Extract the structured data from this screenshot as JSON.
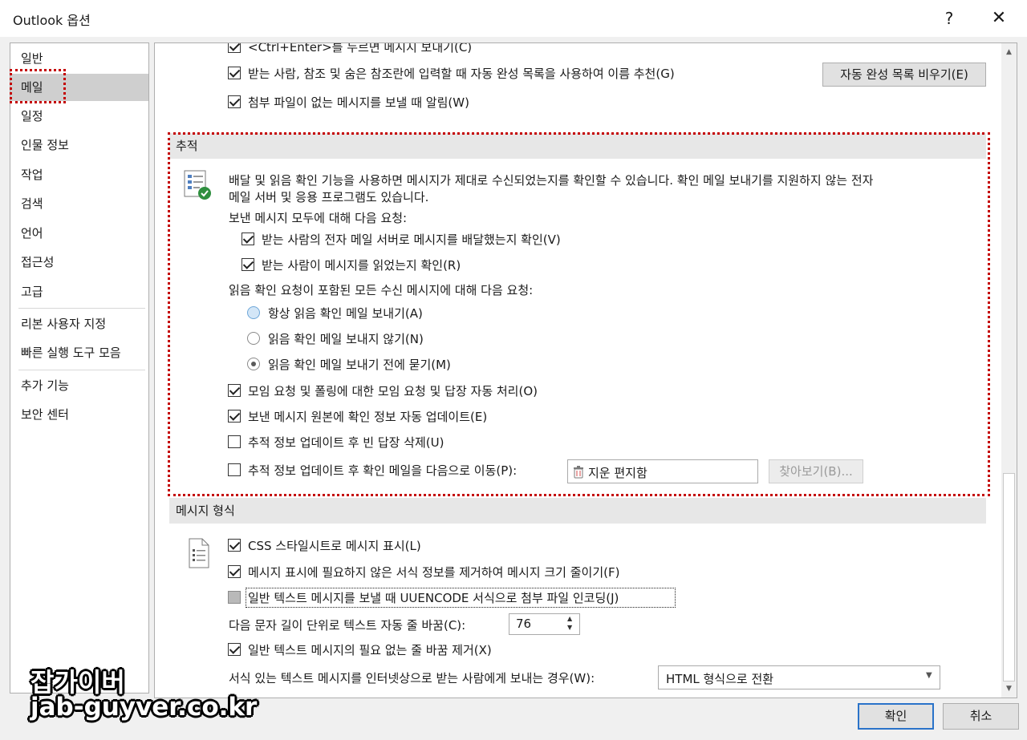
{
  "window": {
    "title": "Outlook 옵션",
    "help": "?",
    "close": "✕"
  },
  "nav": {
    "items": [
      "일반",
      "메일",
      "일정",
      "인물 정보",
      "작업",
      "검색",
      "언어",
      "접근성",
      "고급",
      "리본 사용자 지정",
      "빠른 실행 도구 모음",
      "추가 기능",
      "보안 센터"
    ],
    "active": "메일"
  },
  "compose": {
    "ctrl_enter": "<Ctrl+Enter>를 누르면 메시지 보내기(C)",
    "autocomplete": "받는 사람, 참조 및 숨은 참조란에 입력할 때 자동 완성 목록을 사용하여 이름 추천(G)",
    "attach_warn": "첨부 파일이 없는 메시지를 보낼 때 알림(W)",
    "clear_autocomplete_btn": "자동 완성 목록 비우기(E)"
  },
  "tracking": {
    "header": "추적",
    "desc1": "배달 및 읽음 확인 기능을 사용하면 메시지가 제대로 수신되었는지를 확인할 수 있습니다. 확인 메일 보내기를 지원하지 않는 전자",
    "desc2": "메일 서버 및 응용 프로그램도 있습니다.",
    "request_label": "보낸 메시지 모두에 대해 다음 요청:",
    "delivery_receipt": "받는 사람의 전자 메일 서버로 메시지를 배달했는지 확인(V)",
    "read_receipt": "받는 사람이 메시지를 읽었는지 확인(R)",
    "incoming_label": "읽음 확인 요청이 포함된 모든 수신 메시지에 대해 다음 요청:",
    "radio_always": "항상 읽음 확인 메일 보내기(A)",
    "radio_never": "읽음 확인 메일 보내지 않기(N)",
    "radio_ask": "읽음 확인 메일 보내기 전에 묻기(M)",
    "auto_process": "모임 요청 및 폴링에 대한 모임 요청 및 답장 자동 처리(O)",
    "auto_update": "보낸 메시지 원본에 확인 정보 자동 업데이트(E)",
    "delete_blank": "추적 정보 업데이트 후 빈 답장 삭제(U)",
    "move_receipt": "추적 정보 업데이트 후 확인 메일을 다음으로 이동(P):",
    "folder_value": "지운 편지함",
    "browse_btn": "찾아보기(B)..."
  },
  "format": {
    "header": "메시지 형식",
    "css": "CSS 스타일시트로 메시지 표시(L)",
    "reduce": "메시지 표시에 필요하지 않은 서식 정보를 제거하여 메시지 크기 줄이기(F)",
    "uuencode": "일반 텍스트 메시지를 보낼 때 UUENCODE 서식으로 첨부 파일 인코딩(J)",
    "wrap_label": "다음 문자 길이 단위로 텍스트 자동 줄 바꿈(C):",
    "wrap_value": "76",
    "remove_breaks": "일반 텍스트 메시지의 필요 없는 줄 바꿈 제거(X)",
    "internet_label": "서식 있는 텍스트 메시지를 인터넷상으로 받는 사람에게 보내는 경우(W):",
    "internet_value": "HTML 형식으로 전환"
  },
  "footer": {
    "ok": "확인",
    "cancel": "취소"
  },
  "watermark": {
    "line1": "잡가이버",
    "line2": "jab-guyver.co.kr"
  },
  "colors": {
    "highlight_box": "#c40000",
    "nav_active": "#cfcfcf",
    "section_header": "#e7e7e7"
  }
}
